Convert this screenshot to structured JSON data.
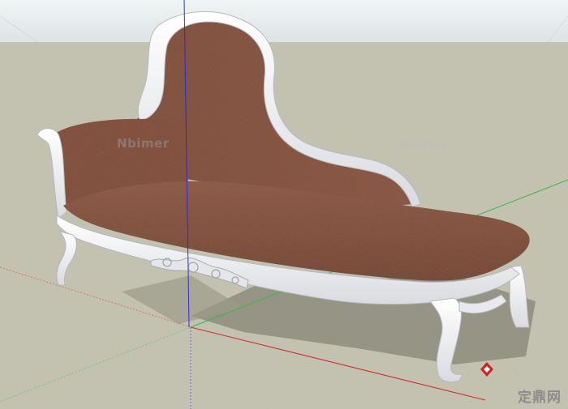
{
  "scene": {
    "sky_color": "#e6ecee",
    "ground_color": "#c3c1af",
    "fabric_color": "#7e4a37",
    "frame_color": "#f3f4f6",
    "axis_red": "#d22a2a",
    "axis_green": "#3bb84a",
    "axis_blue": "#2b2bd6",
    "model_label": "3D model of a tufted chaise longue with white carved frame and brown upholstery"
  },
  "watermarks": {
    "left": "Nbimer",
    "right": "Nbimer"
  },
  "brand": {
    "name": "定鼎网",
    "icon": "logo-icon"
  }
}
